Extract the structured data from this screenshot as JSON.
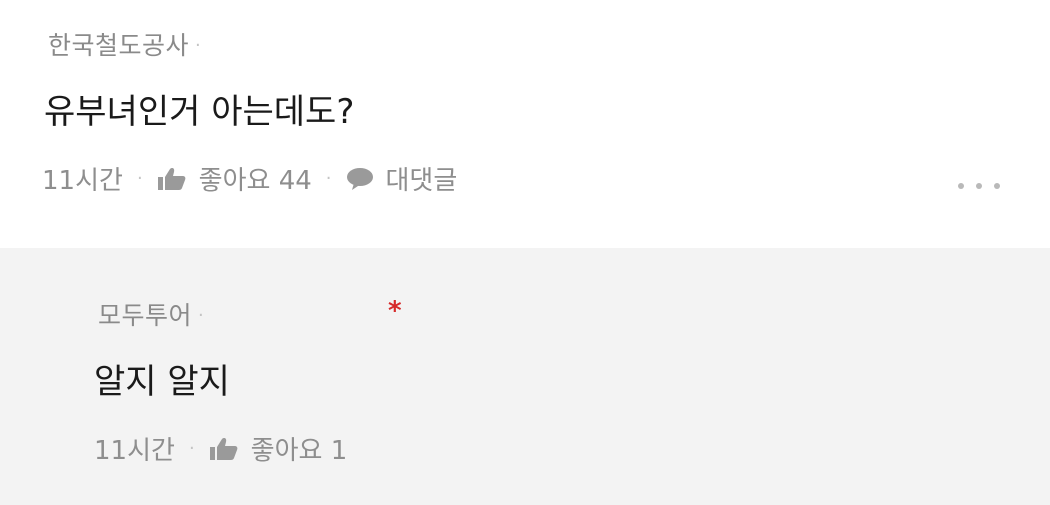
{
  "comment": {
    "author": "한국철도공사",
    "author_dot": "·",
    "text": "유부녀인거 아는데도?",
    "time": "11시간",
    "like_label": "좋아요 44",
    "reply_label": "대댓글",
    "more_icon": "ellipsis-icon"
  },
  "reply": {
    "author": "모두투어",
    "author_dot": "·",
    "marker": "*",
    "text": "알지 알지",
    "time": "11시간",
    "like_label": "좋아요 1"
  },
  "separator": "·",
  "icons": {
    "like": "thumbs-up-icon",
    "reply": "speech-bubble-icon"
  },
  "colors": {
    "reply_background": "#f3f3f3",
    "marker": "#d62a2a",
    "meta_text": "#8e8e8e"
  }
}
